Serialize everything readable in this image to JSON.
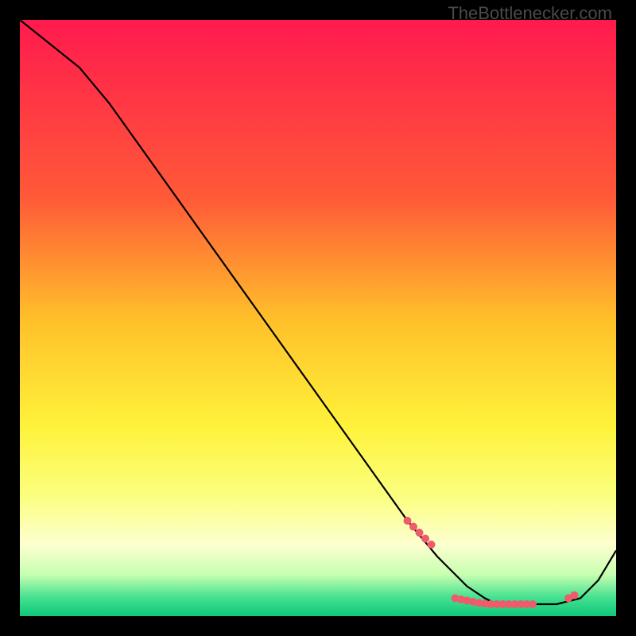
{
  "watermark": "TheBottlenecker.com",
  "chart_data": {
    "type": "line",
    "title": "",
    "xlabel": "",
    "ylabel": "",
    "xlim": [
      0,
      100
    ],
    "ylim": [
      0,
      100
    ],
    "grid": false,
    "background": "rainbow-gradient-vertical",
    "series": [
      {
        "name": "curve",
        "x": [
          0,
          5,
          10,
          15,
          20,
          25,
          30,
          35,
          40,
          45,
          50,
          55,
          60,
          65,
          70,
          72,
          75,
          78,
          80,
          83,
          86,
          90,
          94,
          97,
          100
        ],
        "y": [
          100,
          96,
          92,
          86,
          79,
          72,
          65,
          58,
          51,
          44,
          37,
          30,
          23,
          16,
          10,
          8,
          5,
          3,
          2,
          2,
          2,
          2,
          3,
          6,
          11
        ]
      }
    ],
    "highlight_points": {
      "name": "dots",
      "x": [
        65,
        66,
        67,
        68,
        69,
        73,
        74,
        75,
        76,
        77,
        78,
        79,
        80,
        81,
        82,
        83,
        84,
        85,
        86,
        92,
        93
      ],
      "y": [
        16,
        15,
        14,
        13,
        12,
        3.0,
        2.8,
        2.6,
        2.4,
        2.2,
        2.1,
        2.0,
        2.0,
        2.0,
        2.0,
        2.0,
        2.0,
        2.0,
        2.0,
        3.0,
        3.5
      ]
    },
    "gradient_stops": [
      {
        "offset": 0,
        "color": "#ff1a4e"
      },
      {
        "offset": 0.3,
        "color": "#ff5a38"
      },
      {
        "offset": 0.5,
        "color": "#ffbf2a"
      },
      {
        "offset": 0.68,
        "color": "#fff23a"
      },
      {
        "offset": 0.8,
        "color": "#fbff80"
      },
      {
        "offset": 0.88,
        "color": "#fdffd0"
      },
      {
        "offset": 0.93,
        "color": "#c8ffb0"
      },
      {
        "offset": 0.97,
        "color": "#40e090"
      },
      {
        "offset": 1.0,
        "color": "#10c878"
      }
    ],
    "dot_color": "#ef5b6b",
    "line_color": "#000000"
  }
}
